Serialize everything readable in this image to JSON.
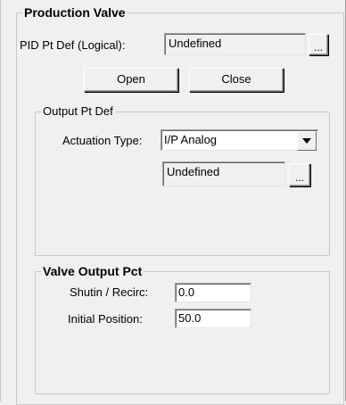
{
  "production_valve": {
    "title": "Production Valve",
    "pid_label": "PID Pt Def (Logical):",
    "pid_value": "Undefined",
    "pid_browse": "...",
    "open_label": "Open",
    "close_label": "Close"
  },
  "output_pt_def": {
    "title": "Output Pt Def",
    "actuation_label": "Actuation Type:",
    "actuation_value": "I/P Analog",
    "point_value": "Undefined",
    "point_browse": "..."
  },
  "valve_output_pct": {
    "title": "Valve Output Pct",
    "shutin_label": "Shutin / Recirc:",
    "shutin_value": "0.0",
    "initial_label": "Initial Position:",
    "initial_value": "50.0"
  }
}
